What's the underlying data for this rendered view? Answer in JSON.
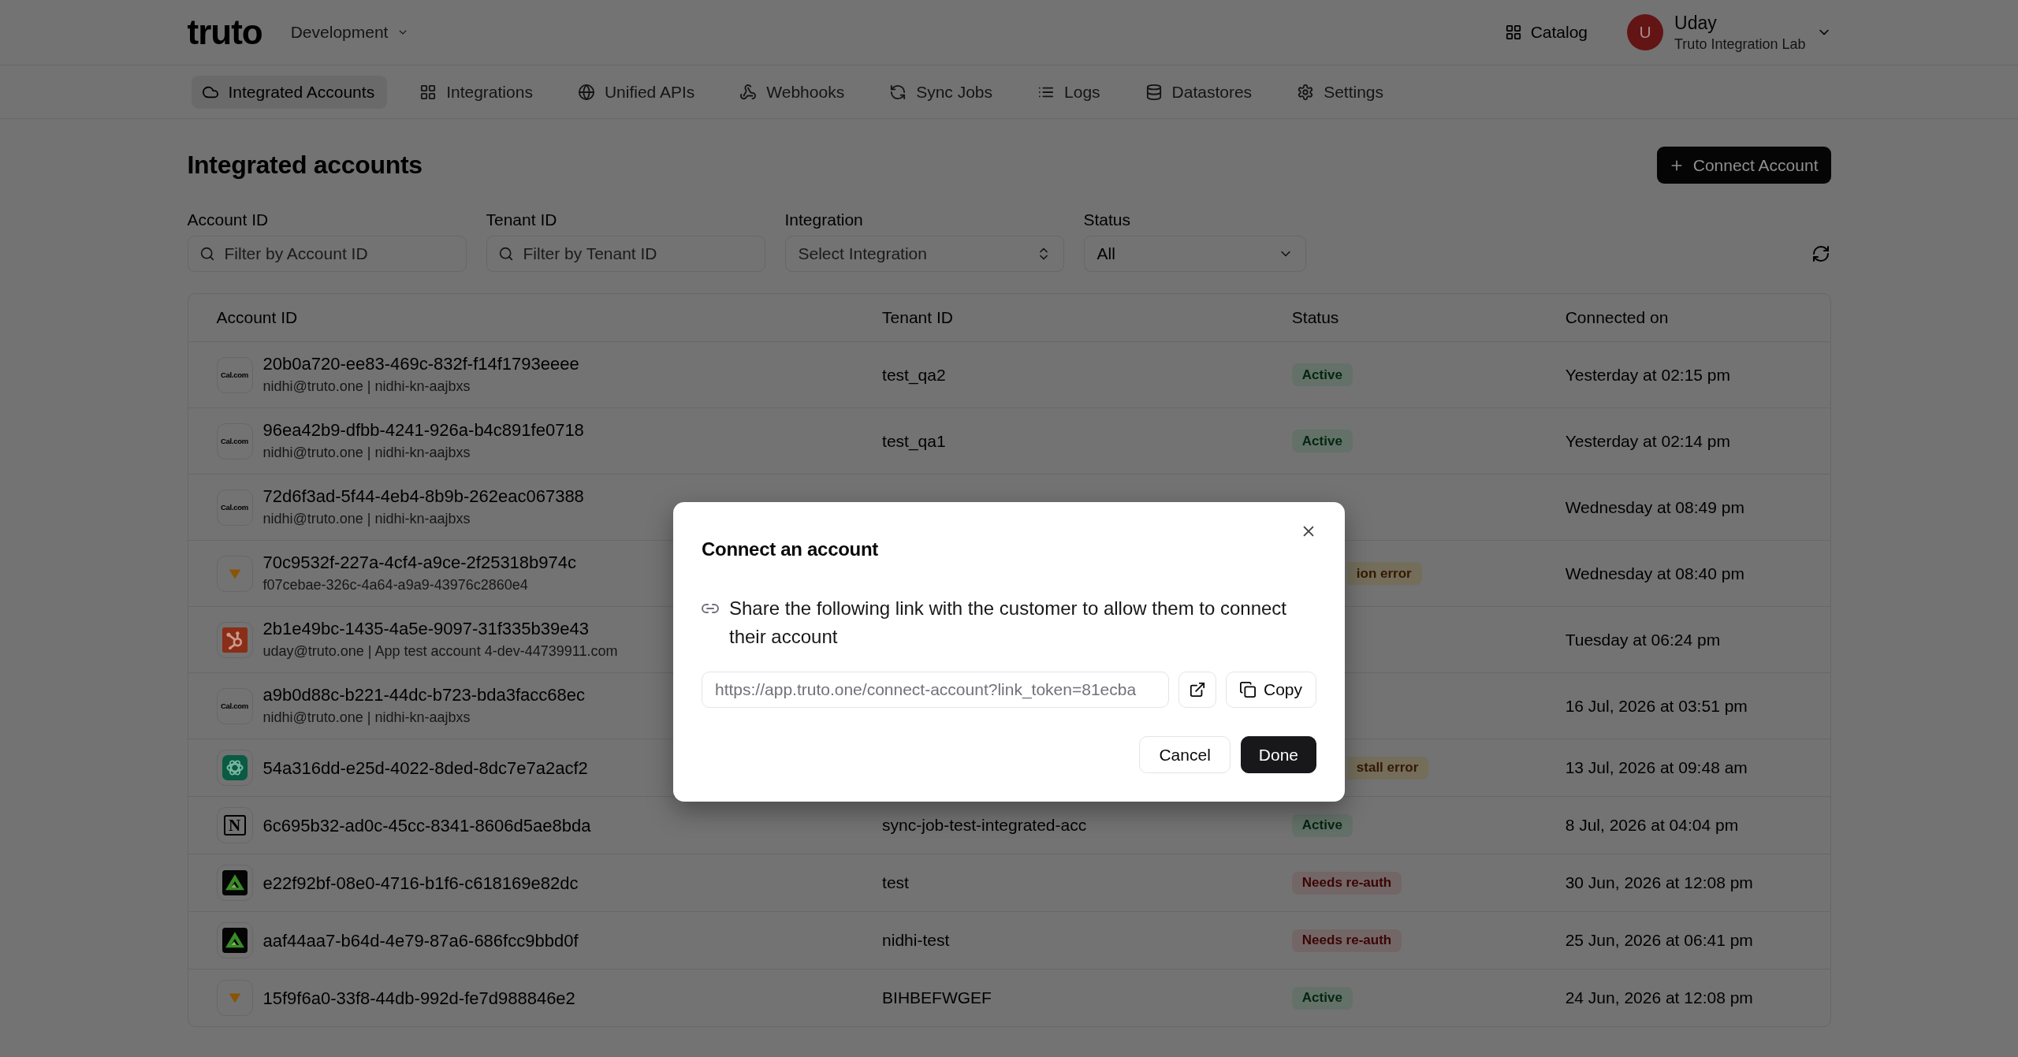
{
  "header": {
    "logo": "truto",
    "environment": "Development",
    "catalog": "Catalog",
    "user": {
      "initial": "U",
      "name": "Uday",
      "org": "Truto Integration Lab"
    }
  },
  "nav": [
    {
      "label": "Integrated Accounts",
      "selected": true
    },
    {
      "label": "Integrations",
      "selected": false
    },
    {
      "label": "Unified APIs",
      "selected": false
    },
    {
      "label": "Webhooks",
      "selected": false
    },
    {
      "label": "Sync Jobs",
      "selected": false
    },
    {
      "label": "Logs",
      "selected": false
    },
    {
      "label": "Datastores",
      "selected": false
    },
    {
      "label": "Settings",
      "selected": false
    }
  ],
  "page": {
    "title": "Integrated accounts",
    "action": "Connect Account"
  },
  "filters": [
    {
      "kind": "search",
      "label": "Account ID",
      "placeholder": "Filter by Account ID"
    },
    {
      "kind": "search",
      "label": "Tenant ID",
      "placeholder": "Filter by Tenant ID"
    },
    {
      "kind": "select",
      "label": "Integration",
      "placeholder": "Select Integration"
    },
    {
      "kind": "dropdown",
      "label": "Status",
      "value": "All"
    }
  ],
  "table": {
    "columns": [
      "Account ID",
      "Tenant ID",
      "Status",
      "Connected on"
    ],
    "rows": [
      {
        "logo": {
          "kind": "text",
          "text": "Cal.com"
        },
        "account_id": "20b0a720-ee83-469c-832f-f14f1793eeee",
        "detail": "nidhi@truto.one | nidhi-kn-aajbxs",
        "tenant_id": "test_qa2",
        "status": {
          "label": "Active",
          "kind": "success",
          "clipped": false
        },
        "connected_on": "Yesterday at 02:15 pm"
      },
      {
        "logo": {
          "kind": "text",
          "text": "Cal.com"
        },
        "account_id": "96ea42b9-dfbb-4241-926a-b4c891fe0718",
        "detail": "nidhi@truto.one | nidhi-kn-aajbxs",
        "tenant_id": "test_qa1",
        "status": {
          "label": "Active",
          "kind": "success",
          "clipped": false
        },
        "connected_on": "Yesterday at 02:14 pm"
      },
      {
        "logo": {
          "kind": "text",
          "text": "Cal.com"
        },
        "account_id": "72d6f3ad-5f44-4eb4-8b9b-262eac067388",
        "detail": "nidhi@truto.one | nidhi-kn-aajbxs",
        "connected_on": "Wednesday at 08:49 pm"
      },
      {
        "logo": {
          "kind": "triangle"
        },
        "account_id": "70c9532f-227a-4cf4-a9ce-2f25318b974c",
        "detail": "f07cebae-326c-4a64-a9a9-43976c2860e4",
        "status": {
          "label": "ion error",
          "kind": "warning",
          "clipped": true
        },
        "connected_on": "Wednesday at 08:40 pm"
      },
      {
        "logo": {
          "kind": "sprocket"
        },
        "account_id": "2b1e49bc-1435-4a5e-9097-31f335b39e43",
        "detail": "uday@truto.one | App test account 4-dev-44739911.com",
        "connected_on": "Tuesday at 06:24 pm"
      },
      {
        "logo": {
          "kind": "text",
          "text": "Cal.com"
        },
        "account_id": "a9b0d88c-b221-44dc-b723-bda3facc68ec",
        "detail": "nidhi@truto.one | nidhi-kn-aajbxs",
        "connected_on": "16 Jul, 2026 at 03:51 pm"
      },
      {
        "logo": {
          "kind": "knot"
        },
        "account_id": "54a316dd-e25d-4022-8ded-8dc7e7a2acf2",
        "status": {
          "label": "stall error",
          "kind": "warning",
          "clipped": true
        },
        "connected_on": "13 Jul, 2026 at 09:48 am"
      },
      {
        "logo": {
          "kind": "letter",
          "text": "N"
        },
        "account_id": "6c695b32-ad0c-45cc-8341-8606d5ae8bda",
        "tenant_id": "sync-job-test-integrated-acc",
        "status": {
          "label": "Active",
          "kind": "success",
          "clipped": false
        },
        "connected_on": "8 Jul, 2026 at 04:04 pm"
      },
      {
        "logo": {
          "kind": "delta"
        },
        "account_id": "e22f92bf-08e0-4716-b1f6-c618169e82dc",
        "tenant_id": "test",
        "status": {
          "label": "Needs re-auth",
          "kind": "danger",
          "clipped": false
        },
        "connected_on": "30 Jun, 2026 at 12:08 pm"
      },
      {
        "logo": {
          "kind": "delta"
        },
        "account_id": "aaf44aa7-b64d-4e79-87a6-686fcc9bbd0f",
        "tenant_id": "nidhi-test",
        "status": {
          "label": "Needs re-auth",
          "kind": "danger",
          "clipped": false
        },
        "connected_on": "25 Jun, 2026 at 06:41 pm"
      },
      {
        "logo": {
          "kind": "triangle"
        },
        "account_id": "15f9f6a0-33f8-44db-992d-fe7d988846e2",
        "tenant_id": "BIHBEFWGEF",
        "status": {
          "label": "Active",
          "kind": "success",
          "clipped": false
        },
        "connected_on": "24 Jun, 2026 at 12:08 pm"
      }
    ]
  },
  "modal": {
    "title": "Connect an account",
    "message": "Share the following link with the customer to allow them to connect their account",
    "link": "https://app.truto.one/connect-account?link_token=81ecba",
    "copy": "Copy",
    "cancel": "Cancel",
    "done": "Done"
  }
}
